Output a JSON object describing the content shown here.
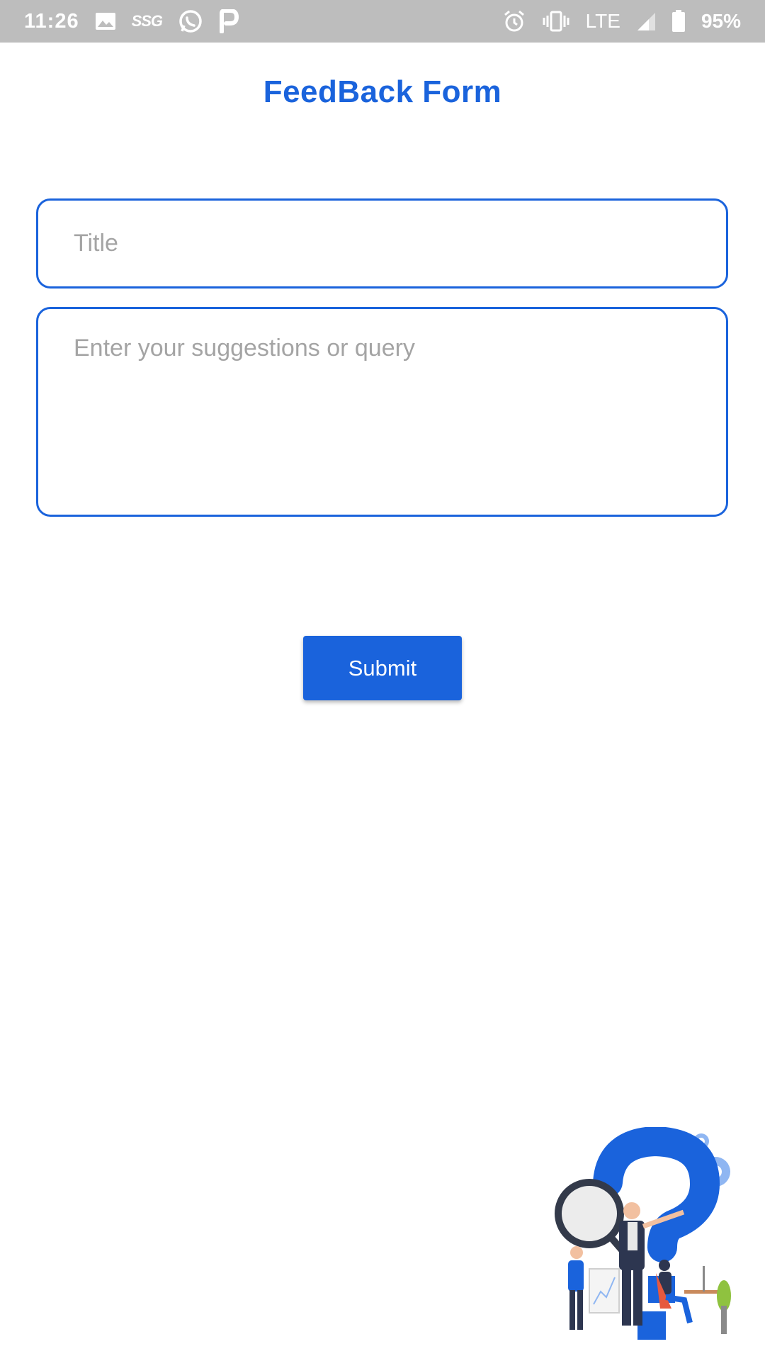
{
  "status_bar": {
    "time": "11:26",
    "left_icons": [
      "image-icon",
      "ssg-icon",
      "whatsapp-icon",
      "p-app-icon"
    ],
    "ssg_label": "SSG",
    "network": "LTE",
    "battery": "95%",
    "right_icons": [
      "alarm-icon",
      "vibrate-icon",
      "signal-icon",
      "battery-icon"
    ]
  },
  "header": {
    "title": "FeedBack Form"
  },
  "form": {
    "title_placeholder": "Title",
    "title_value": "",
    "query_placeholder": "Enter your suggestions or query",
    "query_value": "",
    "submit_label": "Submit"
  },
  "illustration": {
    "icon": "question-mark-team-illustration"
  },
  "colors": {
    "accent": "#1a63dc",
    "status_bar": "#bdbdbd",
    "placeholder": "#a4a4a4"
  }
}
